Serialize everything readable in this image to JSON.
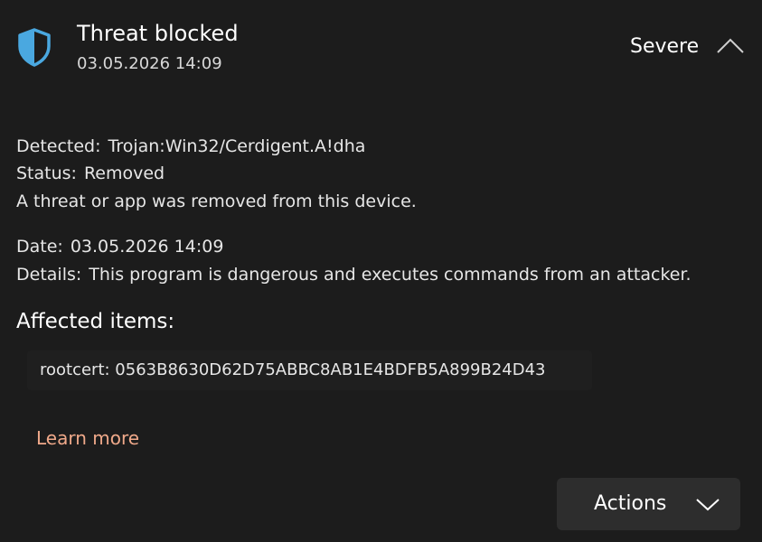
{
  "header": {
    "title": "Threat blocked",
    "timestamp": "03.05.2026 14:09",
    "severity": "Severe"
  },
  "details": {
    "detected_label": "Detected:",
    "detected_value": "Trojan:Win32/Cerdigent.A!dha",
    "status_label": "Status:",
    "status_value": "Removed",
    "status_message": "A threat or app was removed from this device.",
    "date_label": "Date:",
    "date_value": "03.05.2026 14:09",
    "details_label": "Details:",
    "details_value": "This program is dangerous and executes commands from an attacker."
  },
  "affected": {
    "title": "Affected items:",
    "items": [
      "rootcert: 0563B8630D62D75ABBC8AB1E4BDFB5A899B24D43"
    ]
  },
  "links": {
    "learn_more": "Learn more"
  },
  "actions": {
    "label": "Actions"
  },
  "icons": {
    "shield": "shield-icon",
    "collapse": "chevron-up-icon",
    "dropdown": "chevron-down-icon"
  },
  "colors": {
    "background": "#1c1c1c",
    "shield": "#4aa8e0",
    "link": "#f0a98a",
    "button": "#2d2d2d"
  }
}
